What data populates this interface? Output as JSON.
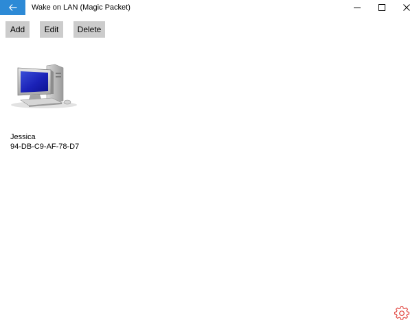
{
  "window": {
    "title": "Wake on LAN (Magic Packet)",
    "accent_color": "#2d8ad6"
  },
  "titlebar_icons": {
    "back": "arrow-left-icon",
    "minimize": "minimize-icon",
    "maximize": "maximize-icon",
    "close": "close-icon"
  },
  "toolbar": {
    "add_label": "Add",
    "edit_label": "Edit",
    "delete_label": "Delete",
    "button_color": "#cccccc"
  },
  "devices": [
    {
      "name": "Jessica",
      "mac": "94-DB-C9-AF-78-D7",
      "icon": "computer-icon"
    }
  ],
  "settings": {
    "icon": "gear-icon",
    "color": "#e0403a"
  }
}
